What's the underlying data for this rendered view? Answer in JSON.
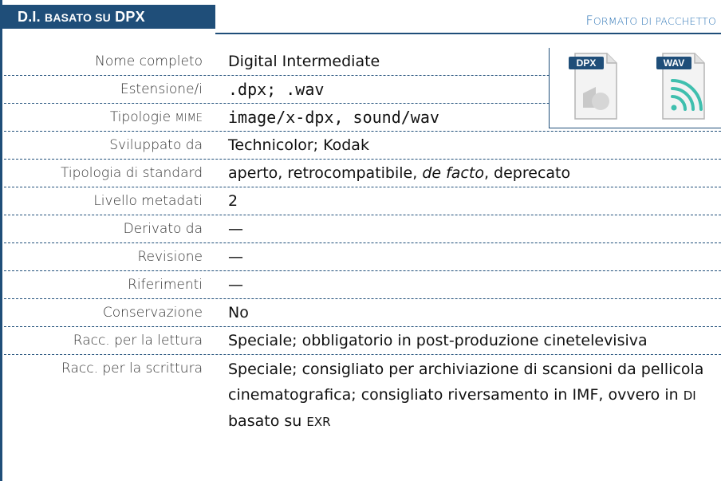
{
  "header": {
    "tag_prefix": "D.I. ",
    "tag_small": "BASATO SU",
    "tag_suffix": " DPX",
    "kind_first": "F",
    "kind_rest_small": "ORMATO DI PACCHETTO"
  },
  "rows": [
    {
      "label": "Nome completo",
      "value": "Digital Intermediate"
    },
    {
      "label": "Estensione/i",
      "value": ".dpx; .wav"
    },
    {
      "label_main": "Tipologie ",
      "label_small": "MIME",
      "value": "image/x-dpx, sound/wav"
    },
    {
      "label": "Sviluppato da",
      "value": "Technicolor; Kodak"
    },
    {
      "label": "Tipologia di standard",
      "value_before": "aperto, retrocompatibile, ",
      "value_em": "de facto",
      "value_after": ", deprecato"
    },
    {
      "label": "Livello metadati",
      "value": "2"
    },
    {
      "label": "Derivato da",
      "value": "—"
    },
    {
      "label": "Revisione",
      "value": "—"
    },
    {
      "label": "Riferimenti",
      "value": "—"
    },
    {
      "label": "Conservazione",
      "value": "No"
    },
    {
      "label": "Racc. per la lettura",
      "value": "Speciale; obbligatorio in post-produzione cinetelevisiva"
    },
    {
      "label": "Racc. per la scrittura",
      "value_text": "Speciale; consigliato per archiviazione di scansioni da pellicola cinematografica; consigliato riversamento in IMF, ovvero in ",
      "value_small_1": "DI",
      "value_mid": " basato su ",
      "value_small_2": "EXR"
    }
  ],
  "icons": {
    "dpx": {
      "label": "DPX",
      "name": "dpx-file-icon"
    },
    "wav": {
      "label": "WAV",
      "name": "wav-file-icon"
    }
  },
  "colors": {
    "accent": "#1f4e79",
    "kind_text": "#2e75b6",
    "dpx_badge": "#1f4e79",
    "wav_badge": "#1f4e79",
    "wav_waves": "#3fbfae"
  }
}
